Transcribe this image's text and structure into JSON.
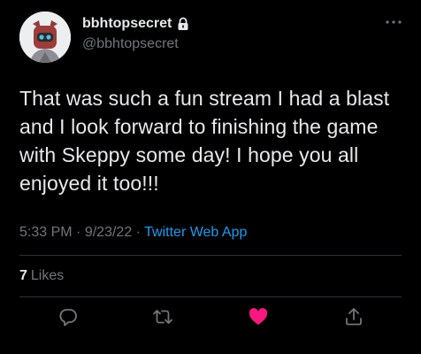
{
  "tweet": {
    "display_name": "bbhtopsecret",
    "handle": "@bbhtopsecret",
    "text": "That was such a fun stream I had a blast and I look forward to finishing the game with Skeppy some day! I hope you all enjoyed it too!!!",
    "time": "5:33 PM",
    "separator": "·",
    "date": "9/23/22",
    "source": "Twitter Web App",
    "likes_count": "7",
    "likes_label": "Likes",
    "liked": true
  },
  "colors": {
    "background": "#000000",
    "text": "#e7e9ea",
    "secondary": "#71767b",
    "link": "#1d9bf0",
    "like": "#f91880",
    "divider": "#2f3336"
  },
  "icons": {
    "lock": "lock-icon",
    "more": "more-horizontal-icon",
    "reply": "reply-icon",
    "retweet": "retweet-icon",
    "like": "heart-filled-icon",
    "share": "share-icon"
  }
}
